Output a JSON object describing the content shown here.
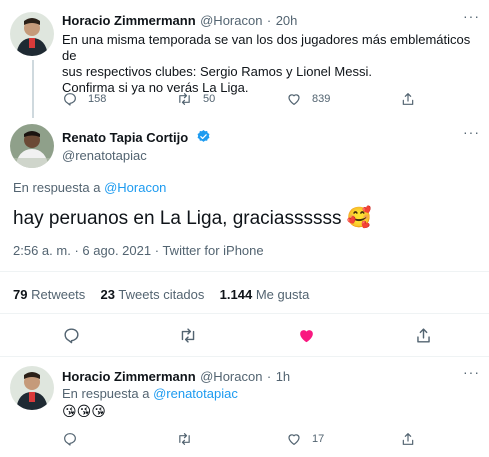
{
  "tweet1": {
    "name": "Horacio Zimmermann",
    "handle": "@Horacon",
    "sep": "·",
    "time": "20h",
    "line1": "En una misma temporada se van los dos jugadores más emblemáticos de",
    "line2": "sus respectivos clubes: Sergio Ramos y Lionel Messi.",
    "line3": "Confirma si ya no verás La Liga.",
    "replies": "158",
    "retweets": "50",
    "likes": "839"
  },
  "main": {
    "name": "Renato Tapia Cortijo",
    "handle": "@renatotapiac",
    "reply_prefix": "En respuesta a",
    "reply_to": "@Horacon",
    "text": "hay peruanos en La Liga, graciassssss",
    "emoji": "🥰",
    "time": "2:56 a. m.",
    "sep1": "·",
    "date": "6 ago. 2021",
    "sep2": "·",
    "source": "Twitter for iPhone",
    "stats": {
      "retweets_num": "79",
      "retweets_label": "Retweets",
      "quotes_num": "23",
      "quotes_label": "Tweets citados",
      "likes_num": "1.144",
      "likes_label": "Me gusta"
    }
  },
  "reply": {
    "name": "Horacio Zimmermann",
    "handle": "@Horacon",
    "sep": "·",
    "time": "1h",
    "reply_prefix": "En respuesta a",
    "reply_to": "@renatotapiac",
    "emojis": "😘😘😘",
    "likes": "17"
  },
  "colors": {
    "accent": "#1d9bf0",
    "like_red": "#f91880",
    "muted": "#536471"
  }
}
